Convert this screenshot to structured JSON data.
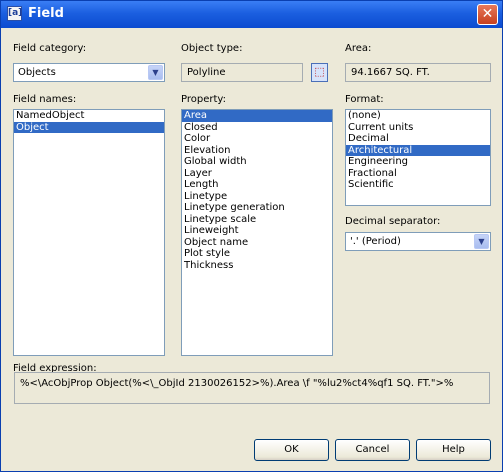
{
  "window": {
    "title": "Field",
    "icon": "field-app-icon",
    "close_icon": "close-icon"
  },
  "field_category": {
    "label": "Field category:",
    "value": "Objects"
  },
  "object_type": {
    "label": "Object type:",
    "value": "Polyline",
    "pick_icon": "select-object-icon"
  },
  "area": {
    "label": "Area:",
    "value": "94.1667 SQ. FT."
  },
  "field_names": {
    "label": "Field names:",
    "items": [
      "NamedObject",
      "Object"
    ],
    "selected": 1
  },
  "property": {
    "label": "Property:",
    "items": [
      "Area",
      "Closed",
      "Color",
      "Elevation",
      "Global width",
      "Layer",
      "Length",
      "Linetype",
      "Linetype generation",
      "Linetype scale",
      "Lineweight",
      "Object name",
      "Plot style",
      "Thickness"
    ],
    "selected": 0
  },
  "format": {
    "label": "Format:",
    "items": [
      "(none)",
      "Current units",
      "Decimal",
      "Architectural",
      "Engineering",
      "Fractional",
      "Scientific"
    ],
    "selected": 3
  },
  "decimal_separator": {
    "label": "Decimal separator:",
    "value": "'.' (Period)"
  },
  "field_expression": {
    "label": "Field expression:",
    "value": "%<\\AcObjProp Object(%<\\_ObjId 2130026152>%).Area \\f \"%lu2%ct4%qf1 SQ. FT.\">%"
  },
  "buttons": {
    "ok": "OK",
    "cancel": "Cancel",
    "help": "Help"
  },
  "colors": {
    "title_bar": "#1b5fe0",
    "selection": "#316ac5",
    "dialog_bg": "#ece9d8"
  }
}
